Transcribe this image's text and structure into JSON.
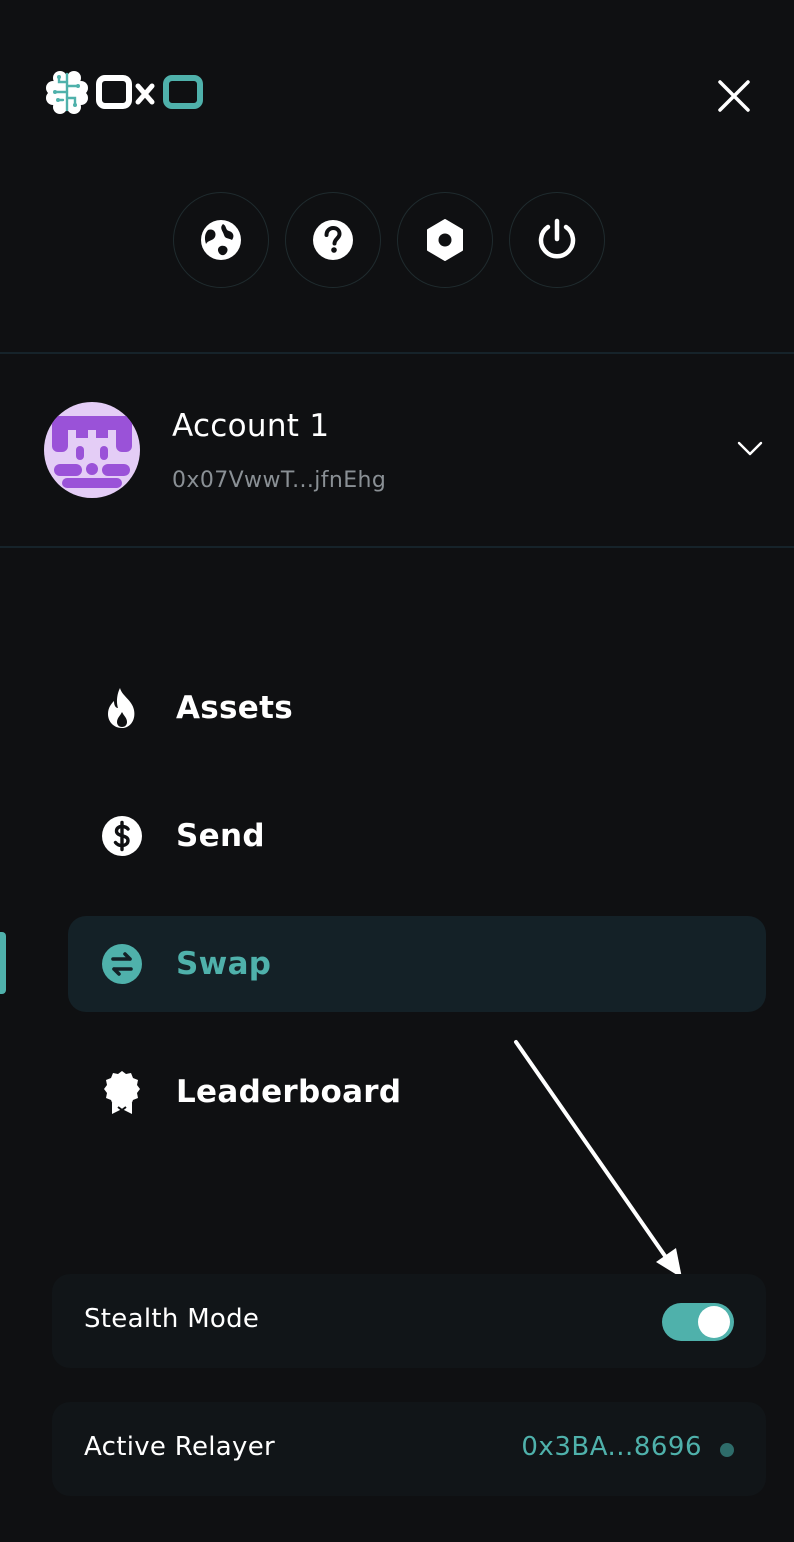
{
  "header": {
    "logo_text": "OxO",
    "close_label": "Close"
  },
  "quick_actions": [
    {
      "icon": "globe-icon",
      "label": "Network"
    },
    {
      "icon": "help-icon",
      "label": "Help"
    },
    {
      "icon": "settings-icon",
      "label": "Settings"
    },
    {
      "icon": "power-icon",
      "label": "Log out"
    }
  ],
  "account": {
    "name": "Account 1",
    "address": "0x07VwwT...jfnEhg",
    "avatar_bg": "#e4cdf6",
    "avatar_fg": "#9a52d8"
  },
  "nav": {
    "items": [
      {
        "label": "Assets",
        "icon": "flame-icon",
        "active": false
      },
      {
        "label": "Send",
        "icon": "dollar-icon",
        "active": false
      },
      {
        "label": "Swap",
        "icon": "swap-icon",
        "active": true
      },
      {
        "label": "Leaderboard",
        "icon": "award-icon",
        "active": false
      }
    ]
  },
  "stealth": {
    "label": "Stealth Mode",
    "enabled": true
  },
  "relayer": {
    "label": "Active Relayer",
    "value": "0x3BA...8696"
  },
  "colors": {
    "accent": "#4fb1ab",
    "background": "#0f1012",
    "active_bg": "#142127"
  }
}
